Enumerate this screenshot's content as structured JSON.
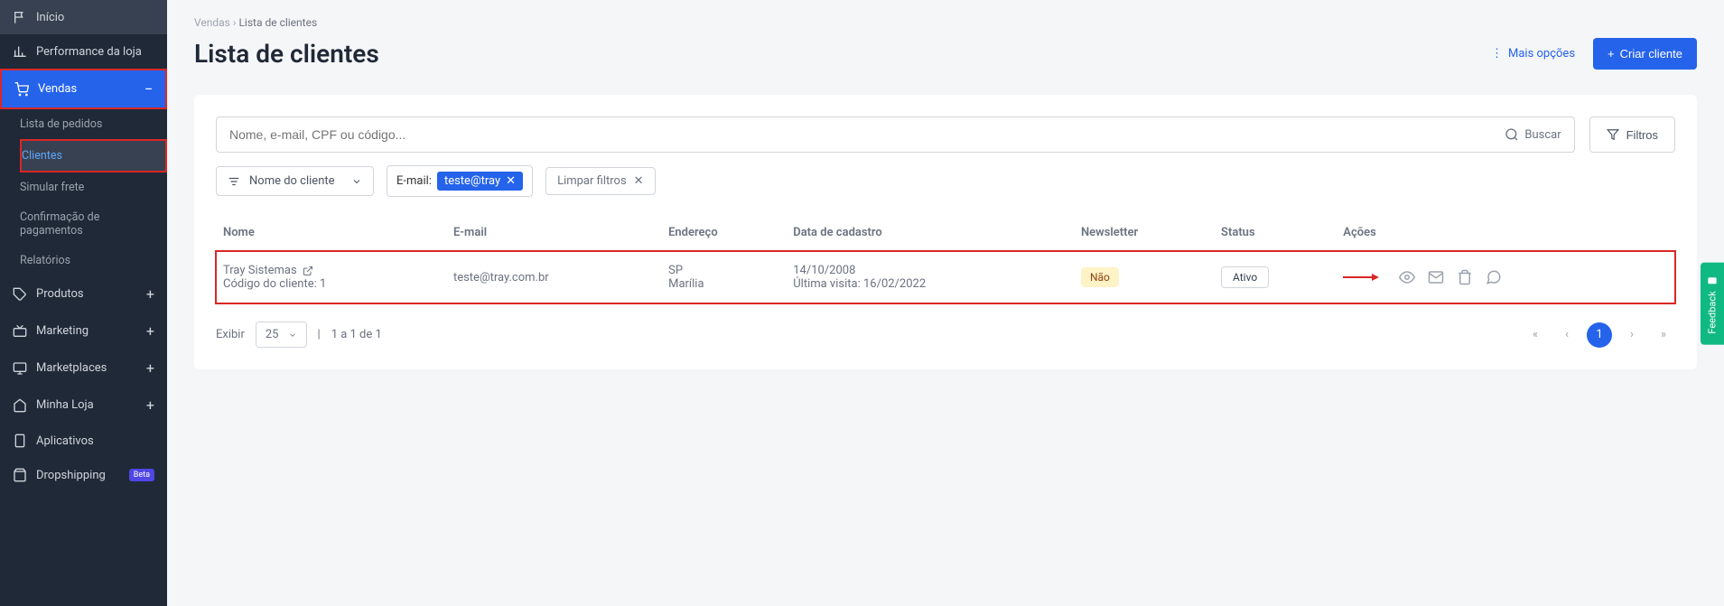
{
  "sidebar": {
    "items": [
      {
        "label": "Início",
        "icon": "flag-icon"
      },
      {
        "label": "Performance da loja",
        "icon": "chart-icon"
      },
      {
        "label": "Vendas",
        "icon": "cart-icon",
        "active": true,
        "expand": "−",
        "border": true
      },
      {
        "label": "Produtos",
        "icon": "tag-icon",
        "expand": "+"
      },
      {
        "label": "Marketing",
        "icon": "tv-icon",
        "expand": "+"
      },
      {
        "label": "Marketplaces",
        "icon": "monitor-icon",
        "expand": "+"
      },
      {
        "label": "Minha Loja",
        "icon": "home-icon",
        "expand": "+"
      },
      {
        "label": "Aplicativos",
        "icon": "phone-icon"
      },
      {
        "label": "Dropshipping",
        "icon": "bag-icon",
        "badge": "Beta"
      }
    ],
    "vendas_sub": [
      {
        "label": "Lista de pedidos"
      },
      {
        "label": "Clientes",
        "active": true,
        "border": true
      },
      {
        "label": "Simular frete"
      },
      {
        "label": "Confirmação de pagamentos"
      },
      {
        "label": "Relatórios"
      }
    ]
  },
  "breadcrumb": {
    "root": "Vendas",
    "sep": "›",
    "current": "Lista de clientes"
  },
  "page_title": "Lista de clientes",
  "header_actions": {
    "more": "Mais opções",
    "create": "Criar cliente"
  },
  "search": {
    "placeholder": "Nome, e-mail, CPF ou código...",
    "button": "Buscar",
    "filters": "Filtros"
  },
  "filters": {
    "sort_label": "Nome do cliente",
    "email_label": "E-mail:",
    "email_value": "teste@tray",
    "clear": "Limpar filtros"
  },
  "table": {
    "headers": {
      "nome": "Nome",
      "email": "E-mail",
      "endereco": "Endereço",
      "cadastro": "Data de cadastro",
      "newsletter": "Newsletter",
      "status": "Status",
      "acoes": "Ações"
    },
    "row": {
      "name": "Tray Sistemas",
      "code_label": "Código do cliente: 1",
      "email": "teste@tray.com.br",
      "addr1": "SP",
      "addr2": "Marília",
      "date1": "14/10/2008",
      "date2": "Última visita: 16/02/2022",
      "newsletter": "Não",
      "status": "Ativo"
    }
  },
  "pagination": {
    "show_label": "Exibir",
    "page_size": "25",
    "range": "1 a 1 de 1",
    "current": "1"
  },
  "feedback": "Feedback"
}
